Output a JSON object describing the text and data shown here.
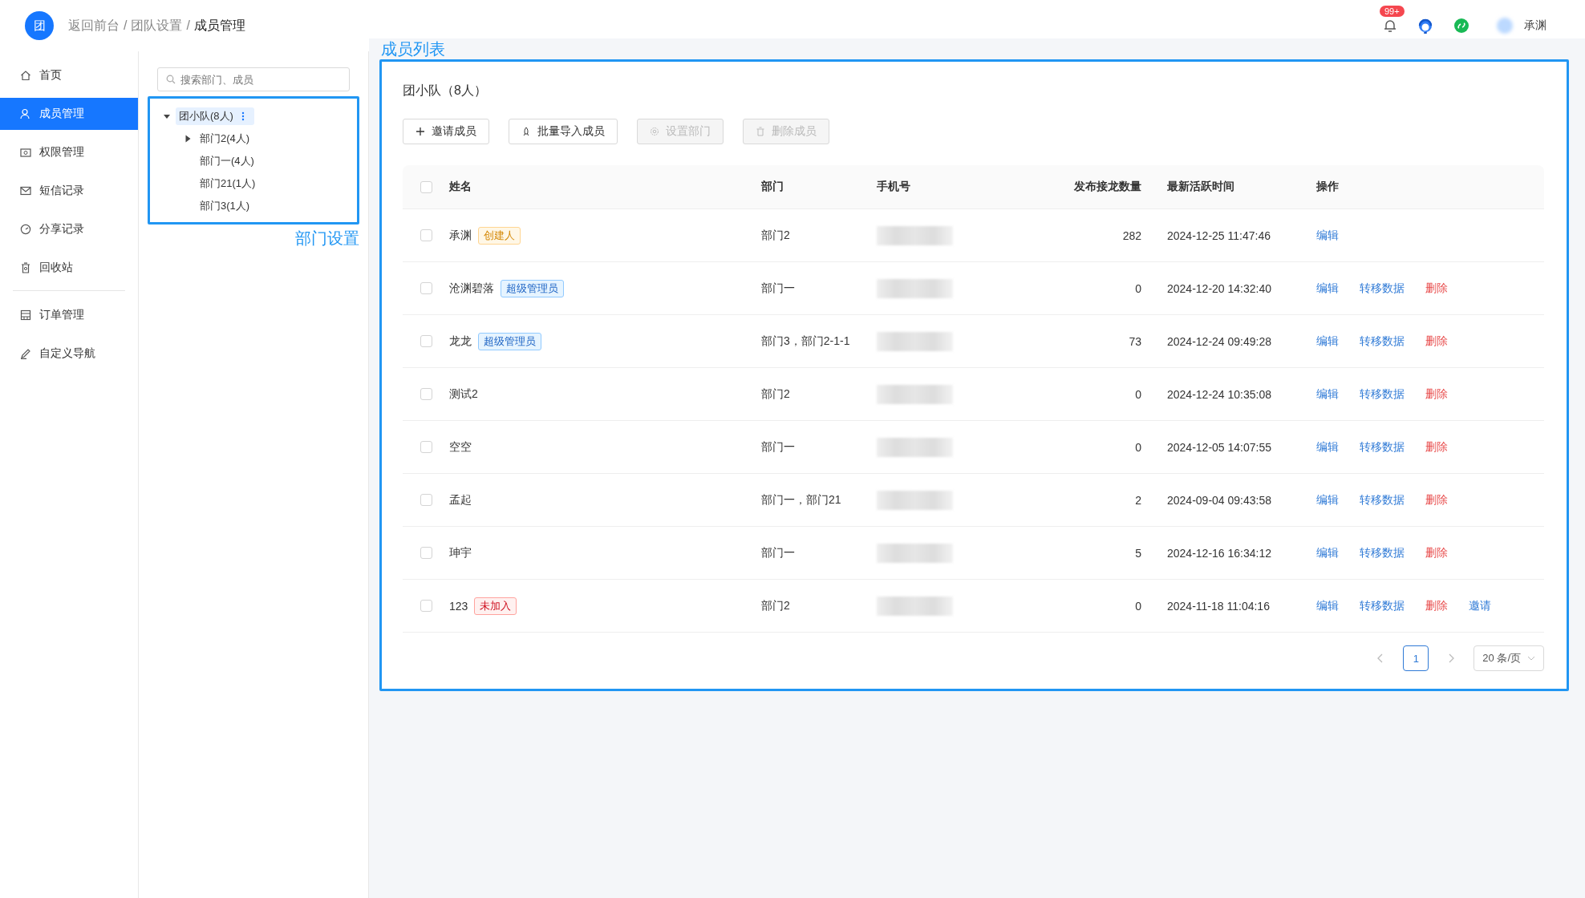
{
  "header": {
    "logo": "团",
    "breadcrumb_separator": "/",
    "breadcrumb": [
      {
        "label": "返回前台",
        "current": false
      },
      {
        "label": "团队设置",
        "current": false
      },
      {
        "label": "成员管理",
        "current": true
      }
    ],
    "notification_badge": "99+",
    "user_name": "承渊"
  },
  "sidebar": {
    "groups": [
      [
        {
          "label": "首页",
          "selected": false
        },
        {
          "label": "成员管理",
          "selected": true
        },
        {
          "label": "权限管理",
          "selected": false
        },
        {
          "label": "短信记录",
          "selected": false
        },
        {
          "label": "分享记录",
          "selected": false
        },
        {
          "label": "回收站",
          "selected": false
        }
      ],
      [
        {
          "label": "订单管理",
          "selected": false
        },
        {
          "label": "自定义导航",
          "selected": false
        }
      ]
    ]
  },
  "tree": {
    "search": {
      "placeholder": "搜索部门、成员"
    },
    "annotation": "部门设置",
    "root": {
      "label": "团小队(8人)",
      "expanded": true,
      "selected": true,
      "children": [
        {
          "label": "部门2(4人)",
          "kind": "branch",
          "expanded": false,
          "selected": false
        },
        {
          "label": "部门一(4人)",
          "kind": "leaf",
          "selected": false
        },
        {
          "label": "部门21(1人)",
          "kind": "leaf",
          "selected": false
        },
        {
          "label": "部门3(1人)",
          "kind": "leaf",
          "selected": false
        }
      ]
    }
  },
  "members": {
    "annotation": "成员列表",
    "title": "团小队（8人）",
    "toolbar": [
      {
        "label": "邀请成员",
        "disabled": false
      },
      {
        "label": "批量导入成员",
        "disabled": false
      },
      {
        "label": "设置部门",
        "disabled": true
      },
      {
        "label": "删除成员",
        "disabled": true
      }
    ],
    "table": {
      "header_checked": false,
      "columns": [
        "姓名",
        "部门",
        "手机号",
        "发布接龙数量",
        "最新活跃时间",
        "操作"
      ],
      "rows": [
        {
          "checked": false,
          "name": "承渊",
          "tag": {
            "label": "创建人",
            "kind": "creator"
          },
          "department": "部门2",
          "count": "282",
          "last_active": "2024-12-25 11:47:46",
          "actions": [
            {
              "label": "编辑",
              "kind": "link"
            }
          ]
        },
        {
          "checked": false,
          "name": "沧渊碧落",
          "tag": {
            "label": "超级管理员",
            "kind": "admin"
          },
          "department": "部门一",
          "count": "0",
          "last_active": "2024-12-20 14:32:40",
          "actions": [
            {
              "label": "编辑",
              "kind": "link"
            },
            {
              "label": "转移数据",
              "kind": "link"
            },
            {
              "label": "删除",
              "kind": "danger"
            }
          ]
        },
        {
          "checked": false,
          "name": "龙龙",
          "tag": {
            "label": "超级管理员",
            "kind": "admin"
          },
          "department": "部门3，部门2-1-1",
          "count": "73",
          "last_active": "2024-12-24 09:49:28",
          "actions": [
            {
              "label": "编辑",
              "kind": "link"
            },
            {
              "label": "转移数据",
              "kind": "link"
            },
            {
              "label": "删除",
              "kind": "danger"
            }
          ]
        },
        {
          "checked": false,
          "name": "测试2",
          "department": "部门2",
          "count": "0",
          "last_active": "2024-12-24 10:35:08",
          "actions": [
            {
              "label": "编辑",
              "kind": "link"
            },
            {
              "label": "转移数据",
              "kind": "link"
            },
            {
              "label": "删除",
              "kind": "danger"
            }
          ]
        },
        {
          "checked": false,
          "name": "空空",
          "department": "部门一",
          "count": "0",
          "last_active": "2024-12-05 14:07:55",
          "actions": [
            {
              "label": "编辑",
              "kind": "link"
            },
            {
              "label": "转移数据",
              "kind": "link"
            },
            {
              "label": "删除",
              "kind": "danger"
            }
          ]
        },
        {
          "checked": false,
          "name": "孟起",
          "department": "部门一，部门21",
          "count": "2",
          "last_active": "2024-09-04 09:43:58",
          "actions": [
            {
              "label": "编辑",
              "kind": "link"
            },
            {
              "label": "转移数据",
              "kind": "link"
            },
            {
              "label": "删除",
              "kind": "danger"
            }
          ]
        },
        {
          "checked": false,
          "name": "珅宇",
          "department": "部门一",
          "count": "5",
          "last_active": "2024-12-16 16:34:12",
          "actions": [
            {
              "label": "编辑",
              "kind": "link"
            },
            {
              "label": "转移数据",
              "kind": "link"
            },
            {
              "label": "删除",
              "kind": "danger"
            }
          ]
        },
        {
          "checked": false,
          "name": "123",
          "tag": {
            "label": "未加入",
            "kind": "pending"
          },
          "department": "部门2",
          "count": "0",
          "last_active": "2024-11-18 11:04:16",
          "actions": [
            {
              "label": "编辑",
              "kind": "link"
            },
            {
              "label": "转移数据",
              "kind": "link"
            },
            {
              "label": "删除",
              "kind": "danger"
            },
            {
              "label": "邀请",
              "kind": "link"
            }
          ]
        }
      ]
    },
    "pagination": {
      "pages": [
        {
          "label": "1",
          "selected": true
        }
      ],
      "page_size": "20 条/页"
    }
  }
}
